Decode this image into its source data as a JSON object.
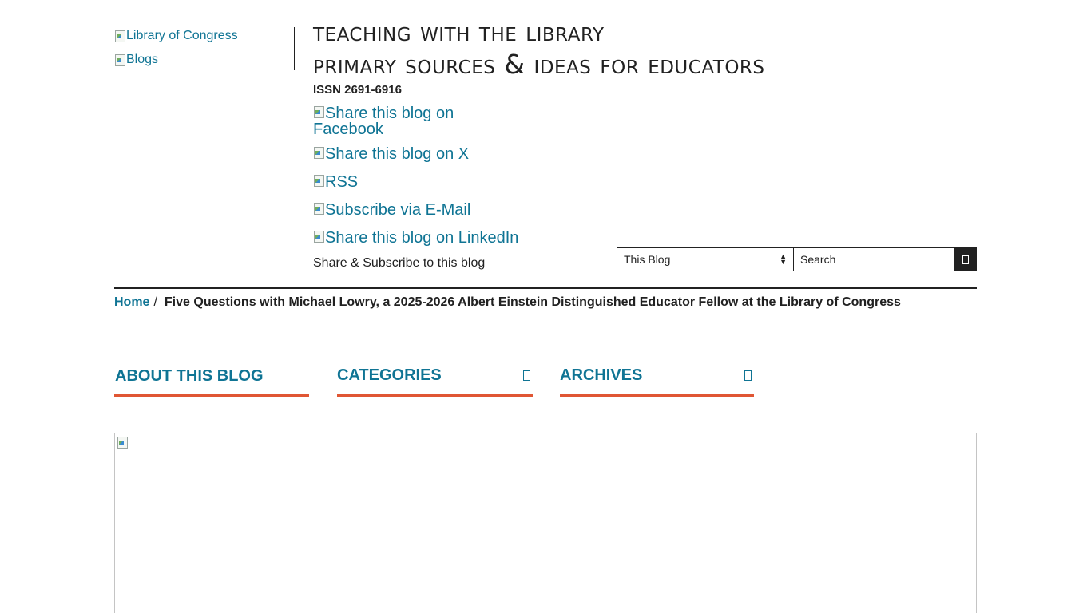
{
  "header": {
    "logo_alt": "Library of Congress",
    "blogs_alt": "Blogs",
    "title_line1": "Teaching with the Library",
    "title_line2": "Primary Sources & Ideas for Educators",
    "issn": "ISSN 2691-6916"
  },
  "share": {
    "facebook_line1": "Share this blog on",
    "facebook_line2": "Facebook",
    "x": "Share this blog on X",
    "rss": "RSS",
    "email": "Subscribe via E-Mail",
    "linkedin": "Share this blog on LinkedIn",
    "caption": "Share & Subscribe to this blog"
  },
  "search": {
    "scope_selected": "This Blog",
    "placeholder": "Search",
    "button_icon": "search-icon"
  },
  "breadcrumb": {
    "home": "Home",
    "separator": "/",
    "current": "Five Questions with Michael Lowry, a 2025-2026 Albert Einstein Distinguished Educator Fellow at the Library of Congress"
  },
  "nav": {
    "about": "ABOUT THIS BLOG",
    "categories": "CATEGORIES",
    "archives": "ARCHIVES",
    "chevron_icon": "chevron-down-icon"
  },
  "colors": {
    "link": "#0f7494",
    "accent_underline": "#e05634",
    "text": "#212121"
  }
}
